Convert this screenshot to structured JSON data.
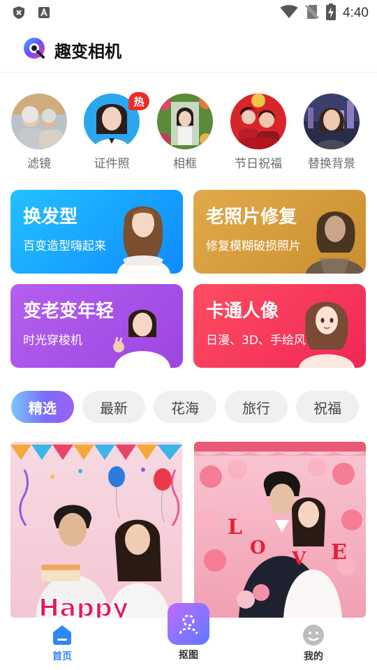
{
  "status_bar": {
    "time": "4:40"
  },
  "header": {
    "title": "趣变相机"
  },
  "features": [
    {
      "label": "滤镜"
    },
    {
      "label": "证件照",
      "badge": "热"
    },
    {
      "label": "相框"
    },
    {
      "label": "节日祝福"
    },
    {
      "label": "替换背景"
    }
  ],
  "cards": [
    {
      "title": "换发型",
      "subtitle": "百变造型嗨起来",
      "color": "#1aa3ff"
    },
    {
      "title": "老照片修复",
      "subtitle": "修复模糊破损照片",
      "color": "#d89a3b"
    },
    {
      "title": "变老变年轻",
      "subtitle": "时光穿梭机",
      "color": "#a855e8"
    },
    {
      "title": "卡通人像",
      "subtitle": "日漫、3D、手绘风",
      "color": "#f23a58"
    }
  ],
  "tabs": [
    {
      "label": "精选",
      "active": true
    },
    {
      "label": "最新"
    },
    {
      "label": "花海"
    },
    {
      "label": "旅行"
    },
    {
      "label": "祝福"
    }
  ],
  "tiles": [
    {
      "theme": "birthday",
      "text": "Happy"
    },
    {
      "theme": "love",
      "text": "LOVE"
    }
  ],
  "nav": [
    {
      "label": "首页",
      "icon": "home-icon",
      "active": true
    },
    {
      "label": "抠图",
      "icon": "cutout-icon"
    },
    {
      "label": "我的",
      "icon": "profile-icon"
    }
  ],
  "colors": {
    "accent": "#2f86f6",
    "hot": "#ee2b2b"
  }
}
